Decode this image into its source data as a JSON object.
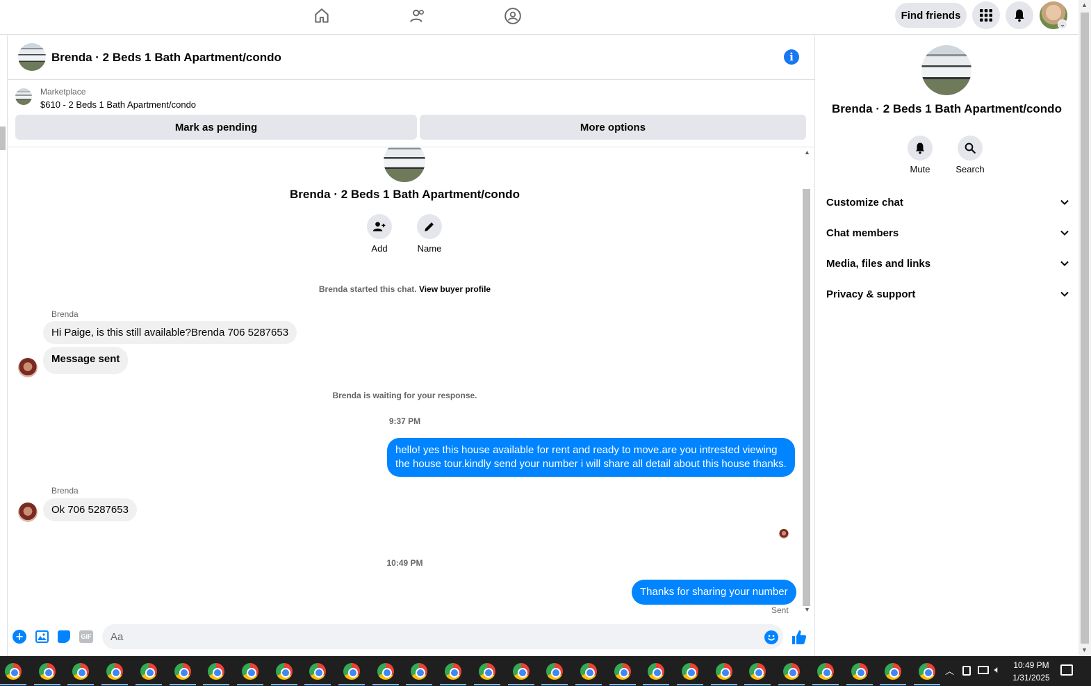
{
  "topnav": {
    "find_friends": "Find friends",
    "icons": [
      "home-icon",
      "friends-icon",
      "groups-icon",
      "menu-grid-icon",
      "bell-icon",
      "profile-avatar"
    ]
  },
  "chat": {
    "title": "Brenda · 2 Beds 1 Bath Apartment/condo",
    "marketplace_label": "Marketplace",
    "listing": "$610 - 2 Beds 1 Bath Apartment/condo",
    "mark_pending": "Mark as pending",
    "more_options": "More options",
    "intro_title": "Brenda · 2 Beds 1 Bath Apartment/condo",
    "add_label": "Add",
    "name_label": "Name",
    "started_text": "Brenda started this chat.",
    "view_profile": "View buyer profile",
    "waiting_text": "Brenda is waiting for your response.",
    "messages": {
      "sender1": "Brenda",
      "msg1": "Hi Paige, is this still available?Brenda 706 5287653",
      "msg2": "Message sent",
      "time1": "9:37 PM",
      "msg3": "hello! yes this house available for rent and ready to move.are you intrested viewing the house tour.kindly send your number i will share all detail about this house thanks.",
      "sender2": "Brenda",
      "msg4": "Ok 706 5287653",
      "time2": "10:49 PM",
      "msg5": "Thanks for sharing your number",
      "status": "Sent"
    },
    "composer_placeholder": "Aa"
  },
  "right_panel": {
    "title": "Brenda · 2 Beds 1 Bath Apartment/condo",
    "mute": "Mute",
    "search": "Search",
    "sections": [
      "Customize chat",
      "Chat members",
      "Media, files and links",
      "Privacy & support"
    ]
  },
  "taskbar": {
    "time": "10:49 PM",
    "date": "1/31/2025"
  },
  "colors": {
    "accent": "#1877f2",
    "outgoing_bubble": "#0084ff",
    "incoming_bubble": "#f0f0f0"
  }
}
